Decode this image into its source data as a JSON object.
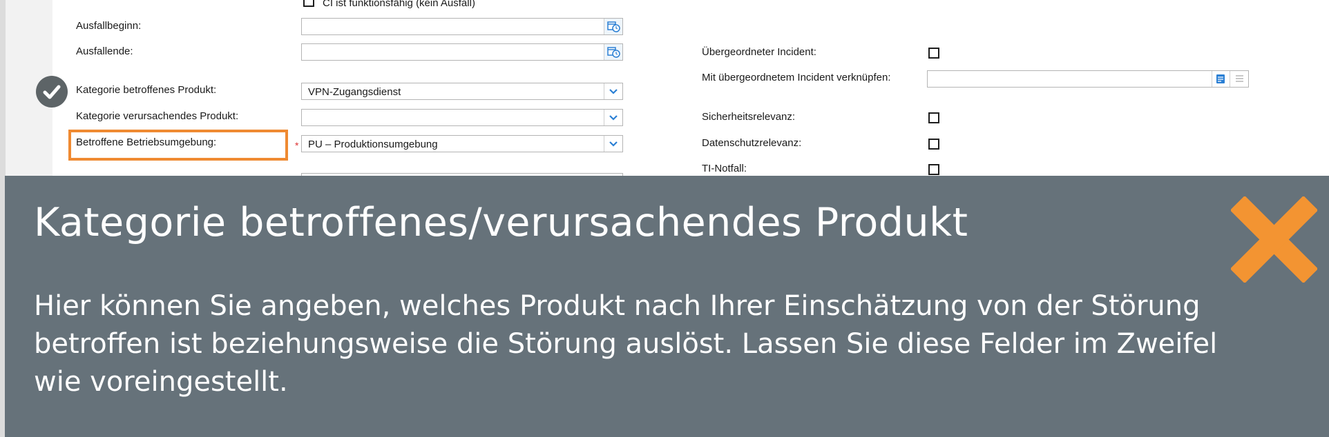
{
  "form": {
    "top_checkbox_label": "CI ist funktionsfähig (kein Ausfall)",
    "left": {
      "ausfallbeginn_label": "Ausfallbeginn:",
      "ausfallbeginn_value": "",
      "ausfallende_label": "Ausfallende:",
      "ausfallende_value": "",
      "kategorie_betroffen_label": "Kategorie betroffenes Produkt:",
      "kategorie_betroffen_value": "VPN-Zugangsdienst",
      "kategorie_verursachend_label": "Kategorie verursachendes Produkt:",
      "kategorie_verursachend_value": "",
      "betriebsumgebung_label": "Betroffene Betriebsumgebung:",
      "betriebsumgebung_required_mark": "*",
      "betriebsumgebung_value": "PU – Produktionsumgebung"
    },
    "right": {
      "uebergeordneter_label": "Übergeordneter Incident:",
      "verknuepfen_label": "Mit übergeordnetem Incident verknüpfen:",
      "verknuepfen_value": "",
      "sicherheit_label": "Sicherheitsrelevanz:",
      "datenschutz_label": "Datenschutzrelevanz:",
      "ti_notfall_label": "TI-Notfall:"
    }
  },
  "help": {
    "title": "Kategorie betroffenes/verursachendes Produkt",
    "body": "Hier können Sie angeben, welches Produkt nach Ihrer Einschätzung von der Störung betroffen ist beziehungsweise die Störung auslöst. Lassen Sie diese Felder im Zweifel wie voreingestellt."
  },
  "colors": {
    "highlight": "#ef8a32",
    "panel_bg": "#66727a",
    "close_icon": "#f39432",
    "check_badge": "#5d6467",
    "dropdown_chevron": "#2a7fd4"
  },
  "icons": {
    "date_picker": "calendar-clock-icon",
    "dropdown": "chevron-down-icon",
    "lookup": "lookup-icon",
    "list": "list-icon",
    "close": "close-icon",
    "completed": "check-icon"
  }
}
